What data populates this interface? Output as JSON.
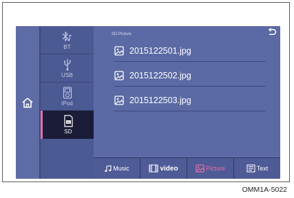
{
  "sources": [
    {
      "label": "BT",
      "icon": "bluetooth-music-icon"
    },
    {
      "label": "USB",
      "icon": "usb-icon"
    },
    {
      "label": "iPod",
      "icon": "ipod-icon"
    },
    {
      "label": "SD",
      "icon": "sd-card-icon",
      "active": true
    }
  ],
  "path": "SD:Picture",
  "files": [
    "2015122501.jpg",
    "2015122502.jpg",
    "2015122503.jpg"
  ],
  "tabs": [
    {
      "label": "Music",
      "icon": "music-note-icon"
    },
    {
      "label": "video",
      "icon": "film-icon"
    },
    {
      "label": "Picture",
      "icon": "picture-icon",
      "active": true
    },
    {
      "label": "Text",
      "icon": "text-doc-icon"
    }
  ],
  "caption": "OMM1A-5022",
  "colors": {
    "background": "#5b6aa4",
    "accent": "#e86fa7",
    "active_source": "#1a1c38"
  }
}
